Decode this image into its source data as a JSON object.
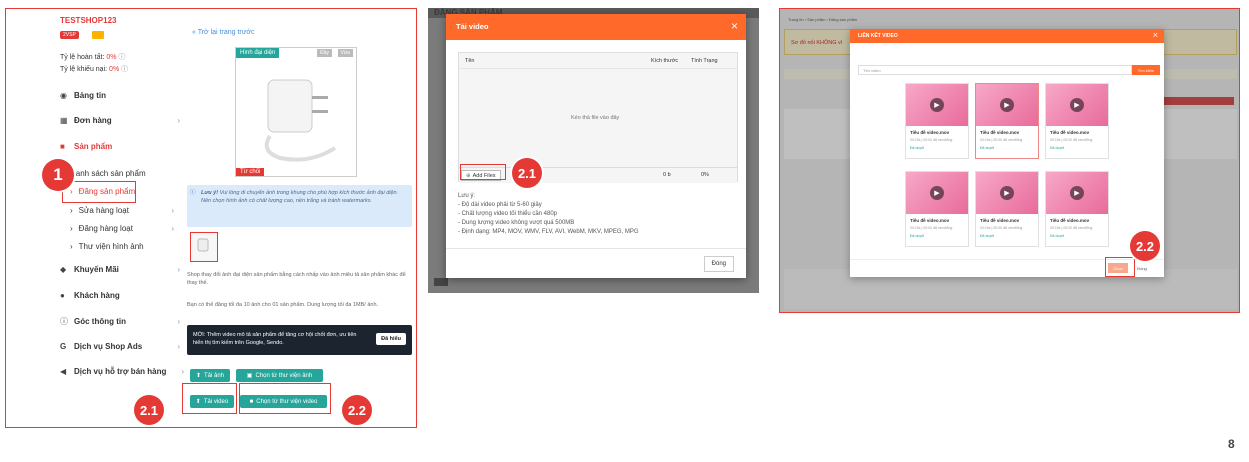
{
  "page_number": "8",
  "badges": {
    "b1": "1",
    "b21": "2.1",
    "b22": "2.2"
  },
  "panel1": {
    "shop_name": "TESTSHOP123",
    "pill_label": "2VSP",
    "pill2": "",
    "rate1_label": "Tỷ lệ hoàn tất:",
    "rate1_value": "0%",
    "rate2_label": "Tỷ lệ khiếu nại:",
    "rate2_value": "0%",
    "menu": [
      {
        "label": "Bảng tin",
        "icon": "dashboard-icon"
      },
      {
        "label": "Đơn hàng",
        "icon": "orders-icon"
      },
      {
        "label": "Sản phẩm",
        "icon": "product-icon"
      },
      {
        "label": "Danh sách sản phẩm"
      },
      {
        "label": "Đăng sản phẩm"
      },
      {
        "label": "Sửa hàng loạt"
      },
      {
        "label": "Đăng hàng loạt"
      },
      {
        "label": "Thư viện hình ảnh"
      },
      {
        "label": "Khuyến Mãi",
        "icon": "tag-icon"
      },
      {
        "label": "Khách hàng",
        "icon": "users-icon"
      },
      {
        "label": "Góc thông tin",
        "icon": "info-icon"
      },
      {
        "label": "Dịch vụ Shop Ads",
        "icon": "google-icon"
      },
      {
        "label": "Dịch vụ hỗ trợ bán hàng",
        "icon": "megaphone-icon"
      }
    ],
    "back_link": "« Trở lại trang trước",
    "image_label": "Hình đại diện",
    "btn_top1": "Đầy",
    "btn_top2": "Vừa",
    "reject_label": "Từ chối",
    "note_bold": "Lưu ý!",
    "note_text": "Vui lòng di chuyển ảnh trong khung cho phù hợp kích thước ảnh đại diện.",
    "note_text2": "Nên chọn hình ảnh có chất lượng cao, nền trắng và tránh watermarks.",
    "desc1": "Shop thay đổi ảnh đại diện sản phẩm bằng cách nhấp vào ảnh miêu tả sản phẩm khác để thay thế.",
    "desc2": "Bạn có thể đăng tối đa 10 ảnh cho 01 sản phẩm. Dung lượng tối đa 1MB/ ảnh.",
    "banner_text": "MỚI: Thêm video mô tả sản phẩm để tăng cơ hội chốt đơn, ưu tiên hiển thị tìm kiếm trên Google, Sendo.",
    "banner_btn": "Đã hiểu",
    "btn_upload_image": "Tải ảnh",
    "btn_library_image": "Chọn từ thư viện ảnh",
    "btn_upload_video": "Tải video",
    "btn_library_video": "Chọn từ thư viện video"
  },
  "panel2": {
    "bg_title": "ĐĂNG SẢN PHẨM",
    "modal_title": "Tải video",
    "close": "×",
    "col_name": "Tên",
    "col_size": "Kích thước",
    "col_status": "Tình Trạng",
    "drop_text": "Kéo thả file vào đây",
    "add_files": "Add Files",
    "size_val": "0 b",
    "pct_val": "0%",
    "notes_title": "Lưu ý:",
    "notes": [
      "- Độ dài video phải từ 5-60 giây",
      "- Chất lượng video tối thiểu cần 480p",
      "- Dung lượng video không vượt quá 500MB",
      "- Định dạng: MP4, MOV, WMV, FLV, AVI, WebM, MKV, MPEG, MPG"
    ],
    "close_btn": "Đóng"
  },
  "panel3": {
    "breadcrumb": "Trang tin › Sản phẩm › Đăng sản phẩm",
    "warning": "Sơ đồ nối KHÔNG vì",
    "modal_title": "LIÊN KẾT VIDEO",
    "close": "×",
    "search_placeholder": "Tên video",
    "search_btn": "Tìm kiếm",
    "cards": [
      {
        "title": "Tiêu đề video.mov",
        "meta": "00:15s | 00:00 đã xem/tổng",
        "status": "Đã duyệt"
      },
      {
        "title": "Tiêu đề video.mov",
        "meta": "00:15s | 00:00 đã xem/tổng",
        "status": "Đã duyệt"
      },
      {
        "title": "Tiêu đề video.mov",
        "meta": "00:15s | 00:00 đã xem/tổng",
        "status": "Đã duyệt"
      },
      {
        "title": "Tiêu đề video.mov",
        "meta": "00:15s | 00:00 đã xem/tổng",
        "status": "Đã duyệt"
      },
      {
        "title": "Tiêu đề video.mov",
        "meta": "00:15s | 00:00 đã xem/tổng",
        "status": "Đã duyệt"
      },
      {
        "title": "Tiêu đề video.mov",
        "meta": "00:15s | 00:00 đã xem/tổng",
        "status": "Đã duyệt"
      }
    ],
    "btn_choose": "Chọn",
    "btn_close": "Đóng"
  },
  "colors": {
    "accent": "#e53935",
    "orange": "#ff6a2b",
    "teal": "#26a69a"
  }
}
